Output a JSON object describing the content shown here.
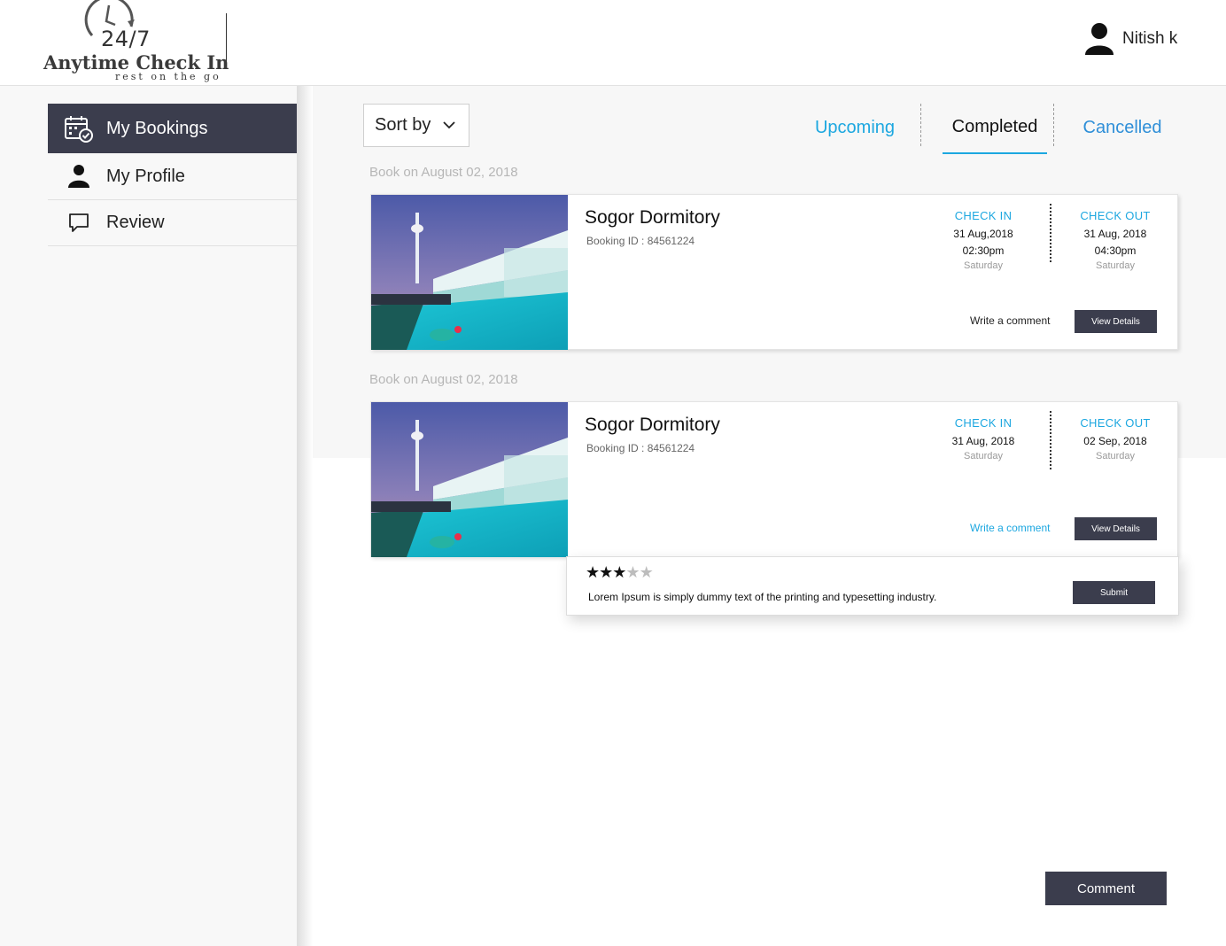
{
  "brand": {
    "number": "24/7",
    "name": "Anytime Check In",
    "tagline": "rest on the go"
  },
  "user": {
    "name": "Nitish k",
    "icon": "user-icon"
  },
  "sidebar": {
    "items": [
      {
        "label": "My Bookings",
        "icon": "calendar-check-icon",
        "active": true
      },
      {
        "label": "My Profile",
        "icon": "user-icon"
      },
      {
        "label": "Review",
        "icon": "speech-bubble-icon"
      }
    ]
  },
  "toolbar": {
    "sort_label": "Sort by"
  },
  "tabs": [
    {
      "label": "Upcoming"
    },
    {
      "label": "Completed",
      "active": true
    },
    {
      "label": "Cancelled"
    }
  ],
  "bookings": [
    {
      "booked_on": "Book on August 02, 2018",
      "title": "Sogor Dormitory",
      "booking_id": "Booking ID : 84561224",
      "check_in": {
        "label": "CHECK IN",
        "date": "31 Aug,2018",
        "time": "02:30pm",
        "day": "Saturday"
      },
      "check_out": {
        "label": "CHECK OUT",
        "date": "31 Aug, 2018",
        "time": "04:30pm",
        "day": "Saturday"
      },
      "comment_label": "Write a comment",
      "view_label": "View Details"
    },
    {
      "booked_on": "Book on August 02, 2018",
      "title": "Sogor Dormitory",
      "booking_id": "Booking ID : 84561224",
      "check_in": {
        "label": "CHECK IN",
        "date": "31 Aug, 2018",
        "day": "Saturday"
      },
      "check_out": {
        "label": "CHECK OUT",
        "date": "02 Sep, 2018",
        "day": "Saturday"
      },
      "comment_label": "Write a comment",
      "view_label": "View Details"
    }
  ],
  "review": {
    "rating": 3,
    "max_rating": 5,
    "text": "Lorem Ipsum is simply dummy text of the printing and typesetting industry.",
    "submit_label": "Submit"
  },
  "comment_button": "Comment",
  "colors": {
    "accent": "#1ca7e0",
    "dark": "#3b3d4d"
  }
}
